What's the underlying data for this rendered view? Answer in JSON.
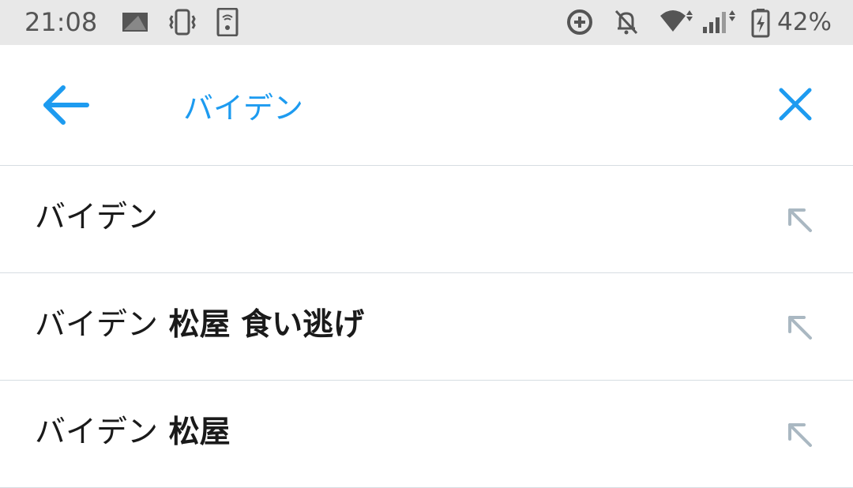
{
  "status_bar": {
    "time": "21:08",
    "battery_percent": "42%",
    "icons": [
      "image-notification-icon",
      "vibrate-icon",
      "wifi-settings-icon",
      "data-saver-icon",
      "notifications-off-icon",
      "wifi-icon",
      "cellular-signal-icon",
      "battery-charging-icon"
    ]
  },
  "search": {
    "query": "バイデン",
    "accent_color": "#1d9bf0"
  },
  "suggestions": [
    {
      "prefix": "バイデン",
      "suffix": ""
    },
    {
      "prefix": "バイデン",
      "suffix": " 松屋 食い逃げ"
    },
    {
      "prefix": "バイデン",
      "suffix": " 松屋"
    }
  ]
}
